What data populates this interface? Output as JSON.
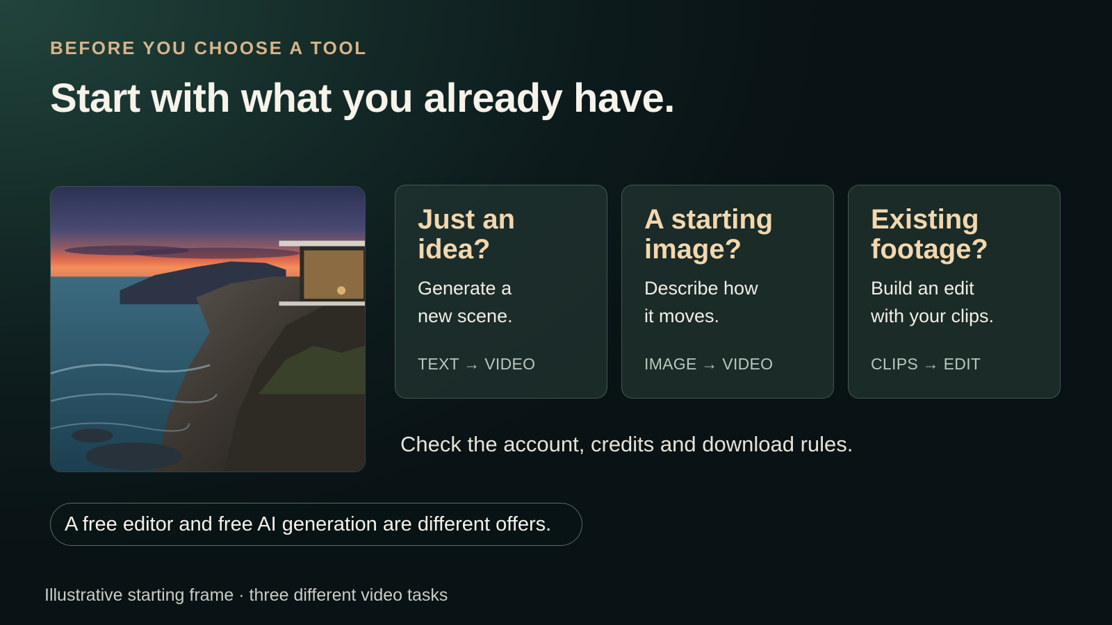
{
  "header": {
    "eyebrow": "BEFORE YOU CHOOSE A TOOL",
    "title": "Start with what you already have."
  },
  "image": {
    "icon": "coastal-cliff-house-photo"
  },
  "cards": [
    {
      "title": "Just an\nidea?",
      "desc": "Generate a\nnew scene.",
      "tag": "TEXT → VIDEO"
    },
    {
      "title": "A starting\nimage?",
      "desc": "Describe how\nit moves.",
      "tag": "IMAGE → VIDEO"
    },
    {
      "title": "Existing\nfootage?",
      "desc": "Build an edit\nwith your clips.",
      "tag": "CLIPS → EDIT"
    }
  ],
  "note": "Check the account, credits and download rules.",
  "pill": "A free editor and free AI generation are different offers.",
  "caption": "Illustrative starting frame · three different video tasks",
  "colors": {
    "accent": "#d9b48a",
    "card_title": "#f3d7ad",
    "background": "#152c29"
  }
}
